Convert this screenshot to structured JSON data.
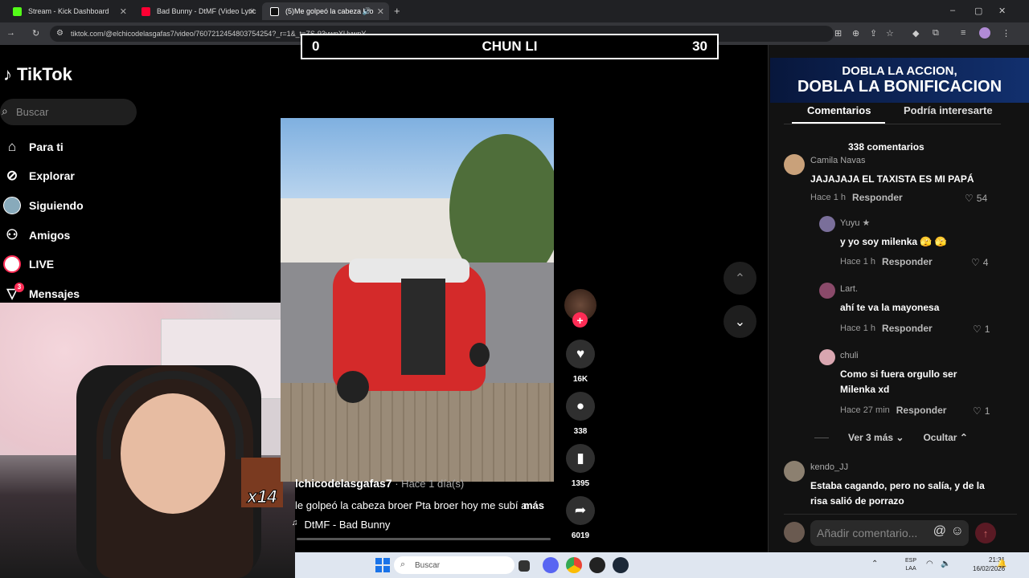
{
  "browser": {
    "tabs": [
      {
        "title": "Stream - Kick Dashboard",
        "color": "#53fc18"
      },
      {
        "title": "Bad Bunny - DtMF (Video Lyric",
        "color": "#ff0033"
      },
      {
        "title": "(5)Me golpeó la cabeza bro",
        "color": "#ffffff"
      }
    ],
    "new_tab": "+",
    "url": "tiktok.com/@elchicodelasgafas7/video/7607212454803754254?_r=1&_t=ZS-93ywnXUywnY",
    "window_controls": [
      "–",
      "▢",
      "✕"
    ]
  },
  "overlay": {
    "score_left": "0",
    "title": "CHUN LI",
    "score_right": "30",
    "streak": "x14"
  },
  "tiktok": {
    "logo": "TikTok",
    "search_placeholder": "Buscar",
    "nav": [
      {
        "label": "Para ti",
        "icon": "home-icon"
      },
      {
        "label": "Explorar",
        "icon": "compass-icon"
      },
      {
        "label": "Siguiendo",
        "icon": "following-icon"
      },
      {
        "label": "Amigos",
        "icon": "friends-icon"
      },
      {
        "label": "LIVE",
        "icon": "live-icon"
      },
      {
        "label": "Mensajes",
        "icon": "messages-icon",
        "badge": "3"
      }
    ],
    "video": {
      "author": "lchicodelasgafas7",
      "time": " · Hace 1 día(s)",
      "caption": "le golpeó la cabeza broer Pta broer hoy me subí a",
      "more": "más",
      "music": "DtMF - Bad Bunny",
      "likes": "16K",
      "comments": "338",
      "saves": "1395",
      "shares": "6019"
    }
  },
  "panel": {
    "ad_line1": "DOBLA LA ACCION,",
    "ad_line2": "DOBLA LA BONIFICACION",
    "tab_comments": "Comentarios",
    "tab_related": "Podría interesarte",
    "comment_count": "338 comentarios",
    "comments": [
      {
        "user": "Camila Navas",
        "text": "JAJAJAJA EL TAXISTA ES MI PAPÁ",
        "time": "Hace 1 h",
        "reply": "Responder",
        "likes": "54",
        "avatar_color": "#c9a17a"
      },
      {
        "user": "Yuyu ★",
        "text": "y yo soy milenka 🫣 🫣",
        "time": "Hace 1 h",
        "reply": "Responder",
        "likes": "4",
        "avatar_color": "#7a6f9a"
      },
      {
        "user": "Lart.",
        "text": "ahí te va la mayonesa",
        "time": "Hace 1 h",
        "reply": "Responder",
        "likes": "1",
        "avatar_color": "#8a4a6a"
      },
      {
        "user": "chuli",
        "text": "Como si fuera orgullo ser Milenka xd",
        "time": "Hace 27 min",
        "reply": "Responder",
        "likes": "1",
        "avatar_color": "#d9a6b0"
      },
      {
        "user": "kendo_JJ",
        "text": "Estaba cagando, pero no salía, y de la risa salió de porrazo",
        "avatar_color": "#8c8070"
      }
    ],
    "view_more": "Ver 3 más",
    "hide": "Ocultar",
    "add_comment_placeholder": "Añadir comentario..."
  },
  "taskbar": {
    "search": "Buscar",
    "lang1": "ESP",
    "lang2": "LAA",
    "time": "21:31",
    "date": "16/02/2026"
  }
}
